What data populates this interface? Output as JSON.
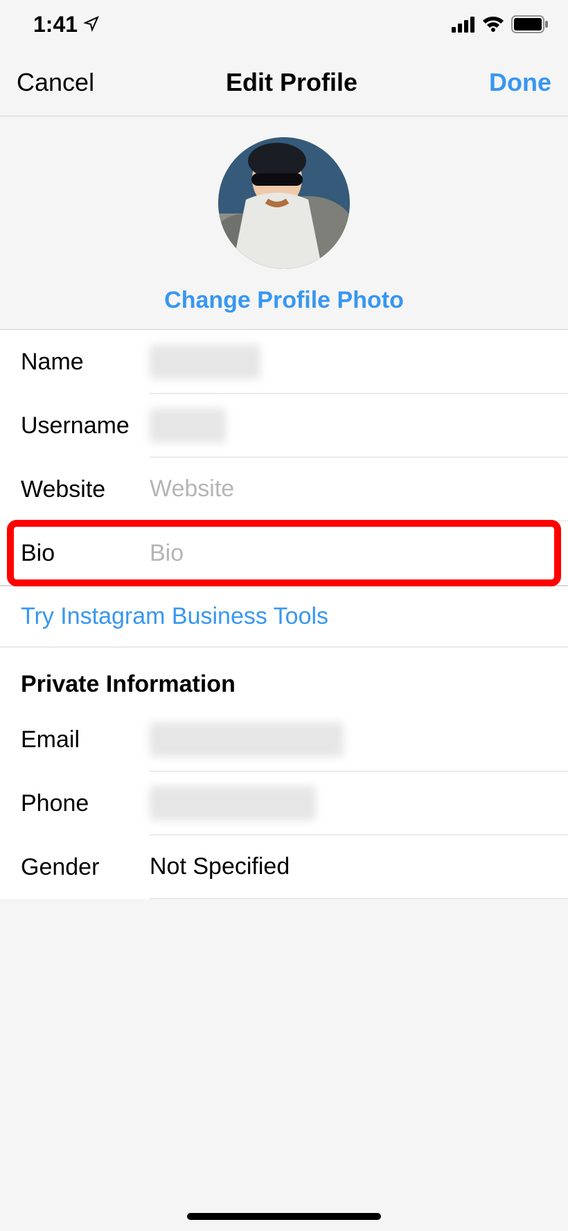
{
  "status": {
    "time": "1:41",
    "location_icon": "location-arrow",
    "signal_icon": "cellular-4-bars",
    "wifi_icon": "wifi-full",
    "battery_icon": "battery-full"
  },
  "nav": {
    "cancel": "Cancel",
    "title": "Edit Profile",
    "done": "Done"
  },
  "photo": {
    "change_label": "Change Profile Photo"
  },
  "fields": {
    "name": {
      "label": "Name",
      "value": ""
    },
    "username": {
      "label": "Username",
      "value": ""
    },
    "website": {
      "label": "Website",
      "value": "",
      "placeholder": "Website"
    },
    "bio": {
      "label": "Bio",
      "value": "",
      "placeholder": "Bio"
    }
  },
  "business_link": "Try Instagram Business Tools",
  "private": {
    "header": "Private Information",
    "email": {
      "label": "Email",
      "value": ""
    },
    "phone": {
      "label": "Phone",
      "value": ""
    },
    "gender": {
      "label": "Gender",
      "value": "Not Specified"
    }
  },
  "colors": {
    "accent": "#3897f0",
    "highlight": "#ff0000"
  }
}
